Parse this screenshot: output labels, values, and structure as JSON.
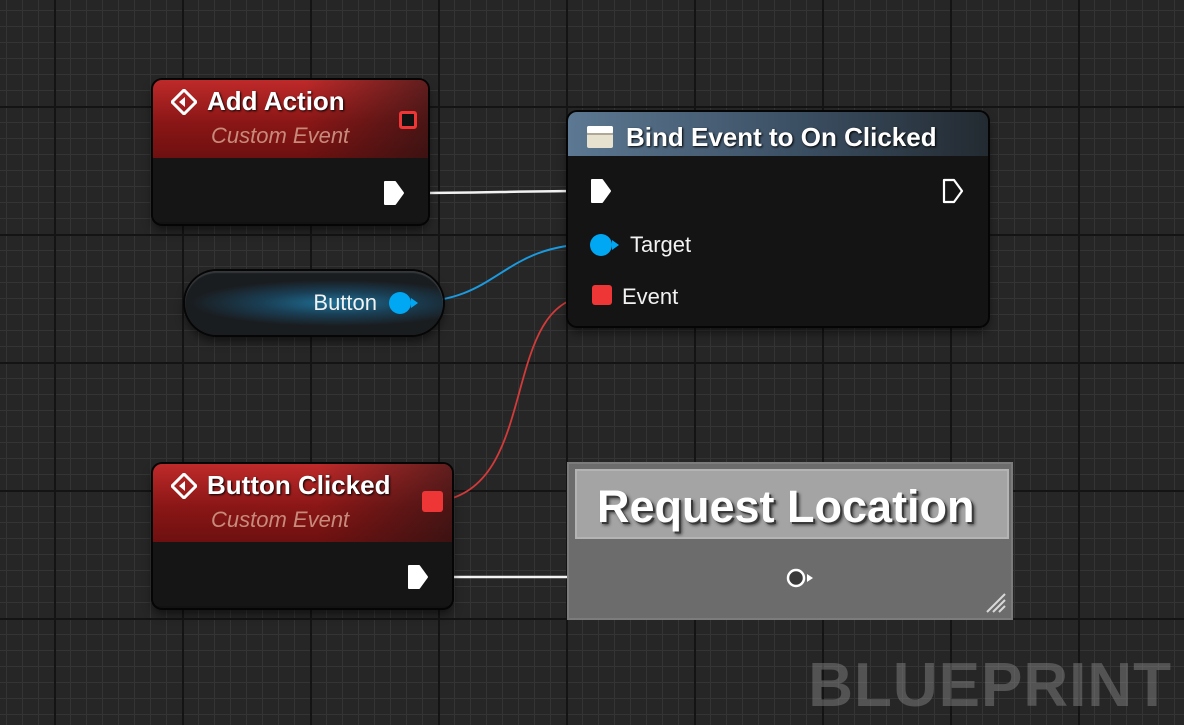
{
  "nodes": {
    "add_action": {
      "title": "Add Action",
      "subtitle": "Custom Event"
    },
    "bind_event": {
      "title": "Bind Event to On Clicked",
      "pins": {
        "target": "Target",
        "event": "Event"
      }
    },
    "button_var": {
      "label": "Button"
    },
    "button_clicked": {
      "title": "Button Clicked",
      "subtitle": "Custom Event"
    },
    "request_location": {
      "title": "Request Location"
    }
  },
  "watermark": "BLUEPRINT",
  "colors": {
    "event_header": "#8a1616",
    "function_header": "#4a6580",
    "object_pin": "#00a8f3",
    "delegate_pin": "#ee3636",
    "exec_wire": "#ffffff",
    "canvas": "#262626"
  },
  "icons": {
    "event": "event-diamond-icon",
    "function": "function-icon",
    "exec": "exec-pin-icon",
    "resize": "resize-grip-icon"
  }
}
